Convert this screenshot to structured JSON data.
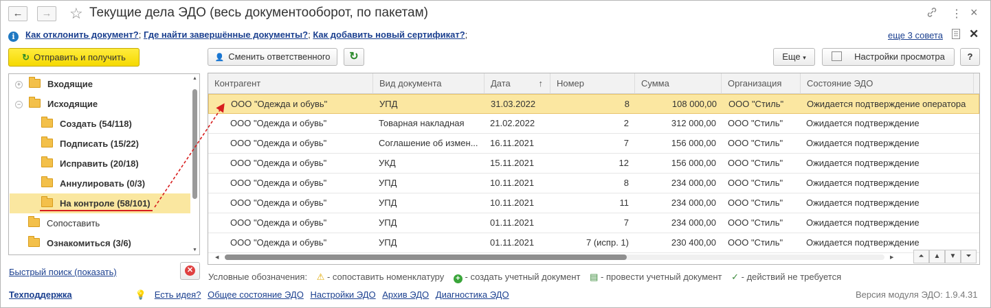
{
  "window": {
    "title": "Текущие дела ЭДО (весь документооборот, по пакетам)",
    "back_icon": "←",
    "forward_icon": "→",
    "star_icon": "☆",
    "link_icon": "🔗",
    "more_icon": "⋮",
    "close_icon": "×"
  },
  "tips": {
    "links": [
      "Как отклонить документ?",
      "Где найти завершённые документы?",
      "Как добавить новый сертификат?"
    ],
    "separator": ";",
    "more": "еще 3 совета",
    "close": "✕"
  },
  "toolbar": {
    "send_receive": "Отправить и получить",
    "change_responsible": "Сменить ответственного",
    "more": "Еще",
    "view_settings": "Настройки просмотра",
    "help": "?"
  },
  "tree": [
    {
      "label": "Входящие",
      "bold": true,
      "level": 0,
      "expander": "+"
    },
    {
      "label": "Исходящие",
      "bold": true,
      "level": 0,
      "expander": "−"
    },
    {
      "label": "Создать (54/118)",
      "bold": true,
      "level": 1
    },
    {
      "label": "Подписать (15/22)",
      "bold": true,
      "level": 1
    },
    {
      "label": "Исправить (20/18)",
      "bold": true,
      "level": 1
    },
    {
      "label": "Аннулировать (0/3)",
      "bold": true,
      "level": 1
    },
    {
      "label": "На контроле (58/101)",
      "bold": true,
      "level": 1,
      "selected": true
    },
    {
      "label": "Сопоставить",
      "bold": false,
      "level": 0
    },
    {
      "label": "Ознакомиться (3/6)",
      "bold": true,
      "level": 0
    }
  ],
  "table": {
    "headers": [
      "Контрагент",
      "Вид документа",
      "Дата",
      "Номер",
      "Сумма",
      "Организация",
      "Состояние ЭДО"
    ],
    "sort_indicator": "↑",
    "rows": [
      [
        "ООО \"Одежда и обувь\"",
        "УПД",
        "31.03.2022",
        "8",
        "108 000,00",
        "ООО \"Стиль\"",
        "Ожидается подтверждение оператора"
      ],
      [
        "ООО \"Одежда и обувь\"",
        "Товарная накладная",
        "21.02.2022",
        "2",
        "312 000,00",
        "ООО \"Стиль\"",
        "Ожидается подтверждение"
      ],
      [
        "ООО \"Одежда и обувь\"",
        "Соглашение об измен...",
        "16.11.2021",
        "7",
        "156 000,00",
        "ООО \"Стиль\"",
        "Ожидается подтверждение"
      ],
      [
        "ООО \"Одежда и обувь\"",
        "УКД",
        "15.11.2021",
        "12",
        "156 000,00",
        "ООО \"Стиль\"",
        "Ожидается подтверждение"
      ],
      [
        "ООО \"Одежда и обувь\"",
        "УПД",
        "10.11.2021",
        "8",
        "234 000,00",
        "ООО \"Стиль\"",
        "Ожидается подтверждение"
      ],
      [
        "ООО \"Одежда и обувь\"",
        "УПД",
        "10.11.2021",
        "11",
        "234 000,00",
        "ООО \"Стиль\"",
        "Ожидается подтверждение"
      ],
      [
        "ООО \"Одежда и обувь\"",
        "УПД",
        "01.11.2021",
        "7",
        "234 000,00",
        "ООО \"Стиль\"",
        "Ожидается подтверждение"
      ],
      [
        "ООО \"Одежда и обувь\"",
        "УПД",
        "01.11.2021",
        "7 (испр. 1)",
        "230 400,00",
        "ООО \"Стиль\"",
        "Ожидается подтверждение"
      ]
    ],
    "selected_row": 0
  },
  "legend": {
    "label": "Условные обозначения:",
    "items": [
      "- сопоставить номенклатуру",
      "- создать учетный документ",
      "- провести учетный документ",
      "- действий не требуется"
    ]
  },
  "quick_search": "Быстрый поиск (показать)",
  "footer": {
    "support": "Техподдержка",
    "links": [
      "Есть идея?",
      "Общее состояние ЭДО",
      "Настройки ЭДО",
      "Архив ЭДО",
      "Диагностика ЭДО"
    ],
    "version": "Версия модуля ЭДО: 1.9.4.31"
  },
  "colors": {
    "accent_yellow": "#f5d900",
    "selection": "#fbe7a1",
    "link": "#1a3f8f",
    "annotation_red": "#d81e1e"
  }
}
